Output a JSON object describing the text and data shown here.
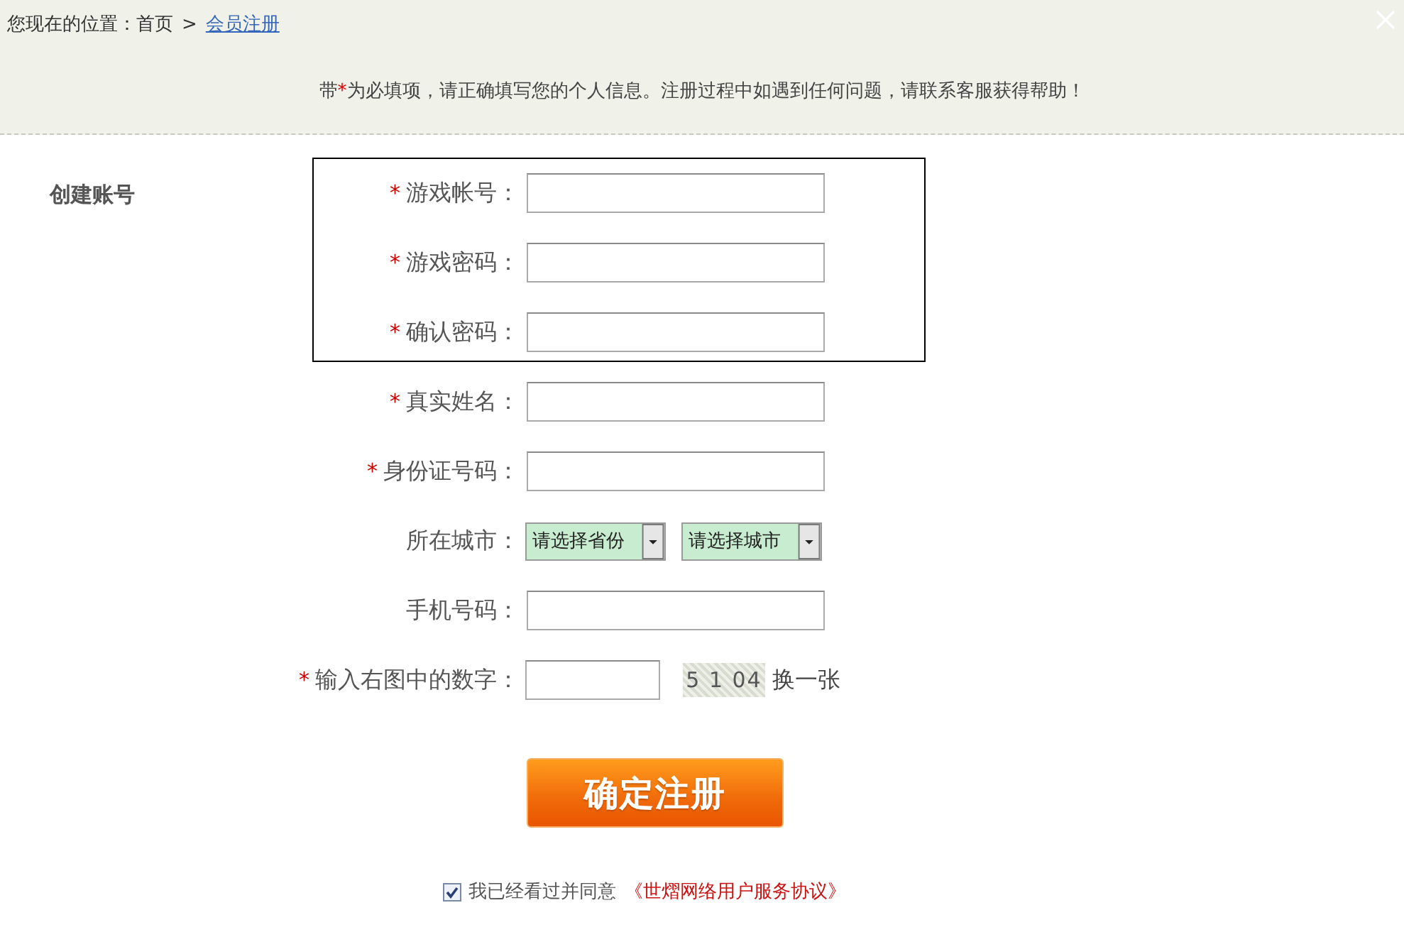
{
  "breadcrumb": {
    "label": "您现在的位置：",
    "items": [
      {
        "text": "首页",
        "kind": "plain"
      },
      {
        "text": "会员注册",
        "kind": "link"
      }
    ],
    "separator": ">"
  },
  "notice": {
    "before": "带",
    "mark": "*",
    "after": "为必填项，请正确填写您的个人信息。注册过程中如遇到任何问题，请联系客服获得帮助！"
  },
  "section": {
    "title": "创建账号"
  },
  "groups": [
    {
      "outlined": true,
      "fields": [
        {
          "kind": "text",
          "required_mark": "*",
          "label": "游戏帐号："
        },
        {
          "kind": "text",
          "required_mark": "*",
          "label": "游戏密码："
        },
        {
          "kind": "text",
          "required_mark": "*",
          "label": "确认密码："
        }
      ]
    },
    {
      "outlined": false,
      "fields": [
        {
          "kind": "text",
          "required_mark": "*",
          "label": "真实姓名："
        },
        {
          "kind": "text",
          "required_mark": "*",
          "label": "身份证号码："
        },
        {
          "kind": "select",
          "label": "所在城市：",
          "selects": [
            {
              "value": "请选择省份"
            },
            {
              "value": "请选择城市"
            }
          ]
        },
        {
          "kind": "text",
          "label": "手机号码："
        },
        {
          "kind": "captcha",
          "required_mark": "*",
          "label": "输入右图中的数字：",
          "captcha": "5 1 04",
          "refresh": "换一张"
        }
      ]
    }
  ],
  "submit": {
    "label": "确定注册"
  },
  "agreement": {
    "checked": true,
    "text": "我已经看过并同意",
    "link": "《世熠网络用户服务协议》"
  }
}
